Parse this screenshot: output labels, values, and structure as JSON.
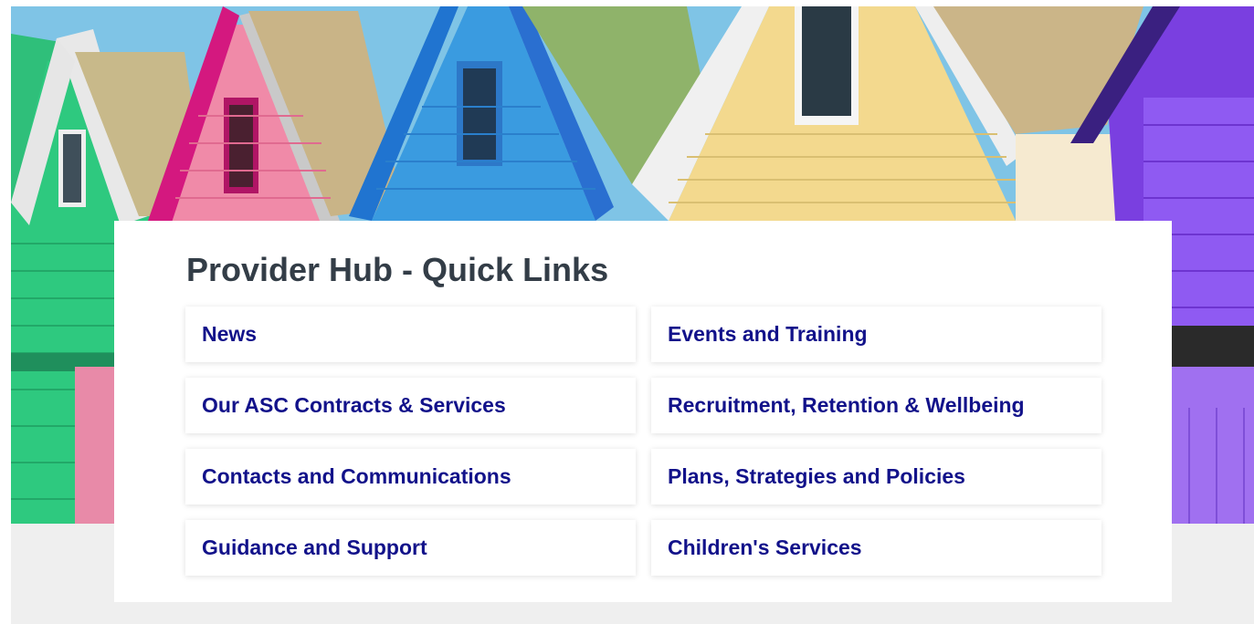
{
  "hero": {
    "icon": "beach-huts-image"
  },
  "card": {
    "title": "Provider Hub - Quick Links"
  },
  "links": [
    {
      "label": "News"
    },
    {
      "label": "Events and Training"
    },
    {
      "label": "Our ASC Contracts & Services"
    },
    {
      "label": "Recruitment, Retention & Wellbeing"
    },
    {
      "label": "Contacts and Communications"
    },
    {
      "label": "Plans, Strategies and Policies"
    },
    {
      "label": "Guidance and Support"
    },
    {
      "label": "Children's Services"
    }
  ],
  "colors": {
    "link_text": "#12128a",
    "title_text": "#333d47",
    "band": "#efefef"
  }
}
